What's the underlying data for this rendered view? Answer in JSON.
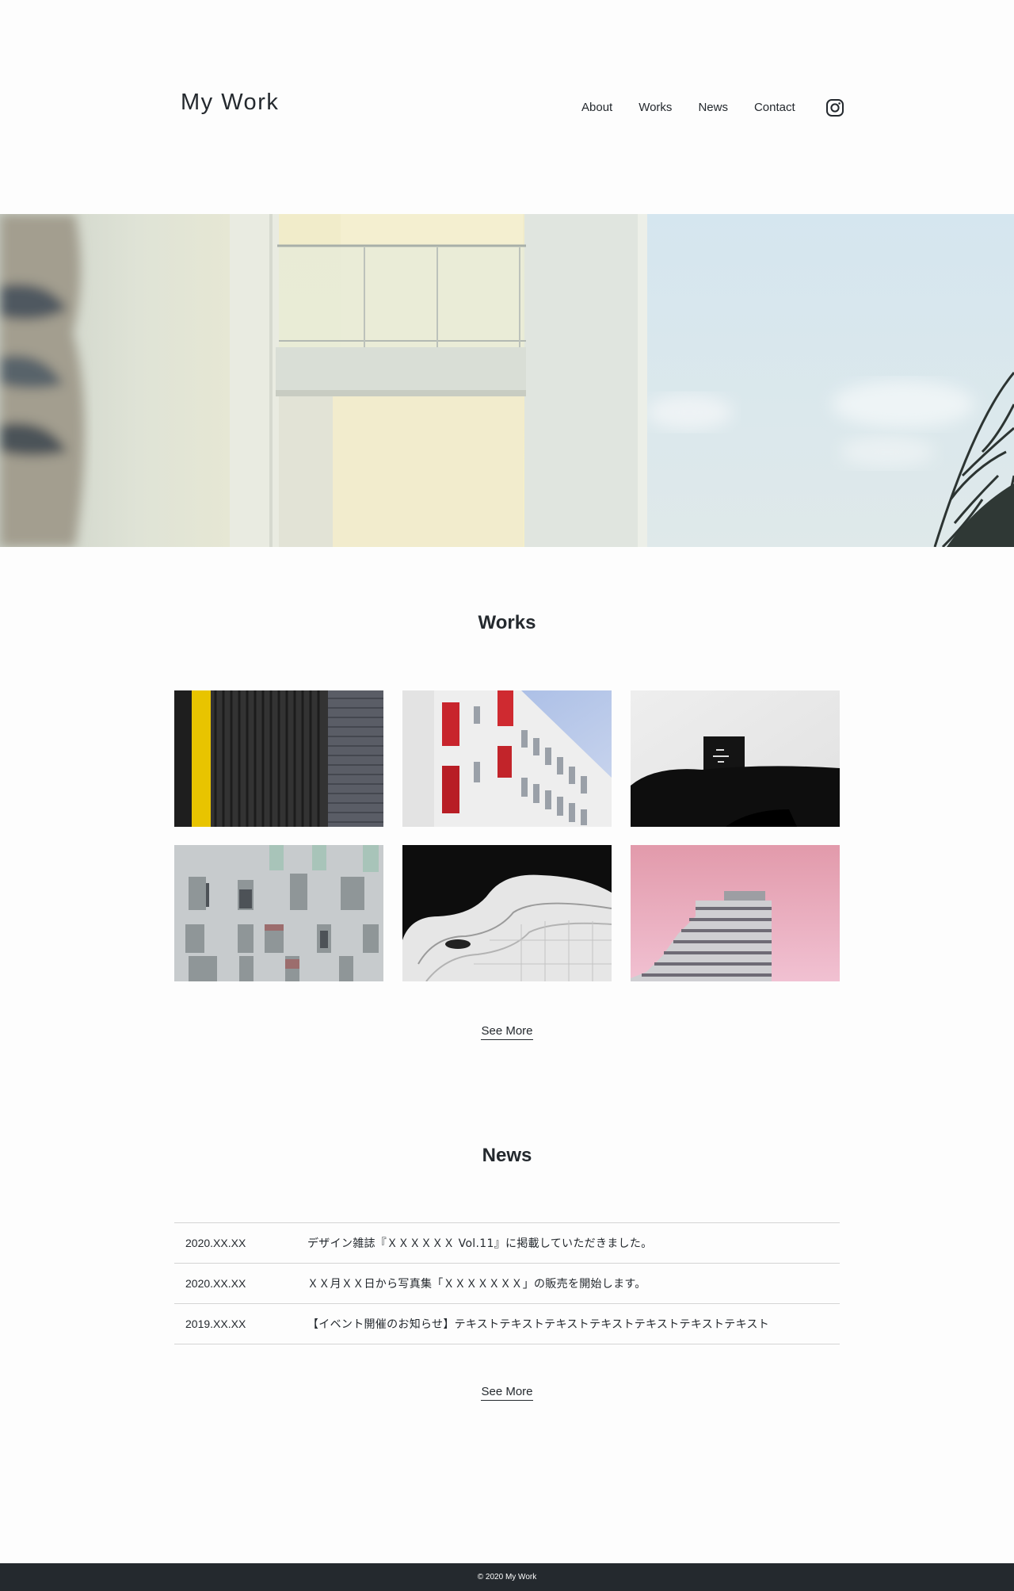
{
  "header": {
    "logo": "My Work",
    "nav": [
      "About",
      "Works",
      "News",
      "Contact"
    ],
    "instagram_icon": "instagram-icon"
  },
  "works": {
    "title": "Works",
    "see_more": "See More",
    "items": [
      {
        "alt": "black and yellow striped wall"
      },
      {
        "alt": "white building with red balconies"
      },
      {
        "alt": "black chair and monitor"
      },
      {
        "alt": "grey facade with windows"
      },
      {
        "alt": "curved white building"
      },
      {
        "alt": "building on pink sky"
      }
    ]
  },
  "news": {
    "title": "News",
    "see_more": "See More",
    "items": [
      {
        "date": "2020.XX.XX",
        "text": "デザイン雑誌『ＸＸＸＸＸＸ Vol.11』に掲載していただきました。"
      },
      {
        "date": "2020.XX.XX",
        "text": "ＸＸ月ＸＸ日から写真集「ＸＸＸＸＸＸＸ」の販売を開始します。"
      },
      {
        "date": "2019.XX.XX",
        "text": "【イベント開催のお知らせ】テキストテキストテキストテキストテキストテキストテキスト"
      }
    ]
  },
  "footer": {
    "copyright": "© 2020 My Work"
  }
}
